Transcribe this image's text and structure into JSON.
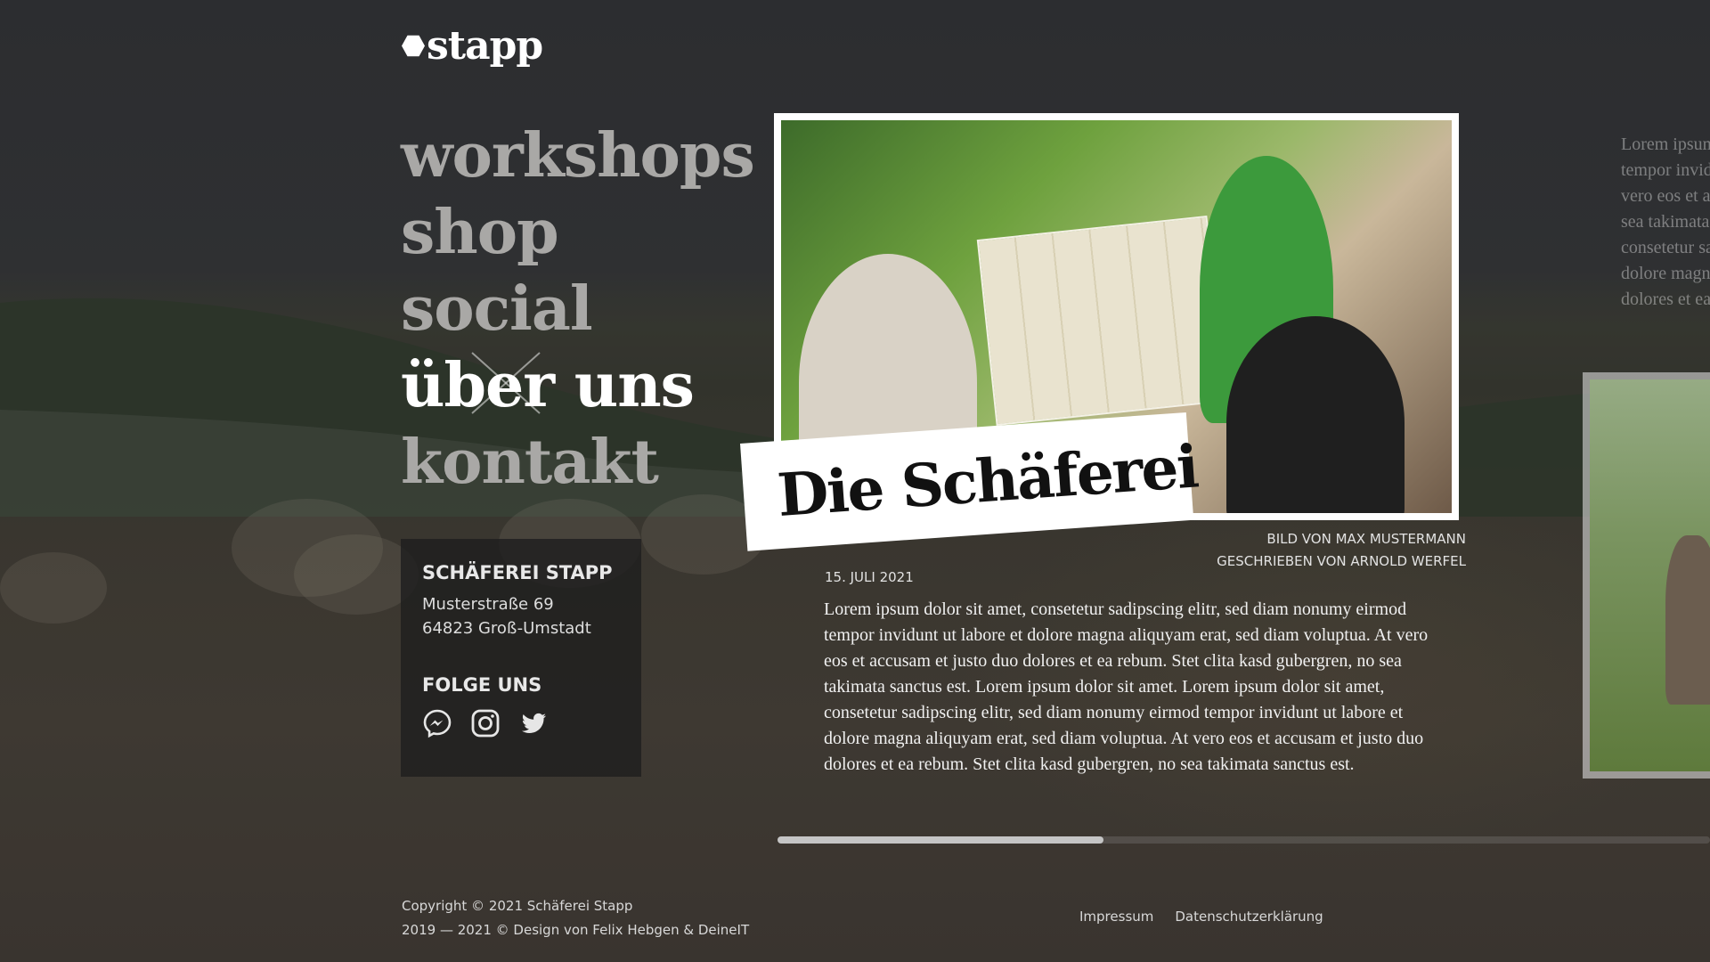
{
  "brand": {
    "name": "stapp"
  },
  "nav": {
    "items": [
      {
        "label": "workshops",
        "active": false
      },
      {
        "label": "shop",
        "active": false
      },
      {
        "label": "social",
        "active": false
      },
      {
        "label": "über uns",
        "active": true
      },
      {
        "label": "kontakt",
        "active": false
      }
    ]
  },
  "info": {
    "company": "SCHÄFEREI STAPP",
    "street": "Musterstraße 69",
    "city": "64823 Groß-Umstadt",
    "follow_heading": "FOLGE UNS",
    "social_icons": [
      "messenger-icon",
      "instagram-icon",
      "twitter-icon"
    ]
  },
  "article": {
    "title": "Die Schäferei",
    "photo_credit": "BILD VON MAX MUSTERMANN",
    "author_credit": "GESCHRIEBEN VON ARNOLD WERFEL",
    "date": "15. JULI 2021",
    "body": "Lorem ipsum dolor sit amet, consetetur sadipscing elitr, sed diam nonumy eirmod tempor invidunt ut labore et dolore magna aliquyam erat, sed diam voluptua. At vero eos et accusam et justo duo dolores et ea rebum. Stet clita kasd gubergren, no sea takimata sanctus est. Lorem ipsum dolor sit amet. Lorem ipsum dolor sit amet, consetetur sadipscing elitr, sed diam nonumy eirmod tempor invidunt ut labore et dolore magna aliquyam erat, sed diam voluptua. At vero eos et accusam et justo duo dolores et ea rebum. Stet clita kasd gubergren, no sea takimata sanctus est."
  },
  "next_preview": {
    "lines": [
      "Lorem ipsum",
      "tempor invidu",
      "vero eos et acc",
      "sea takimata s",
      "consetetur sac",
      "dolore magna",
      "dolores et ea r"
    ]
  },
  "slider": {
    "progress": 0.35
  },
  "footer": {
    "copyright": "Copyright © 2021 Schäferei Stapp",
    "design": "2019 — 2021 © Design von Felix Hebgen & DeineIT",
    "links": [
      "Impressum",
      "Datenschutzerklärung"
    ]
  },
  "colors": {
    "nav_inactive": "#a9a8a6",
    "nav_active": "#ffffff",
    "info_bg": "#1e1e1e"
  }
}
